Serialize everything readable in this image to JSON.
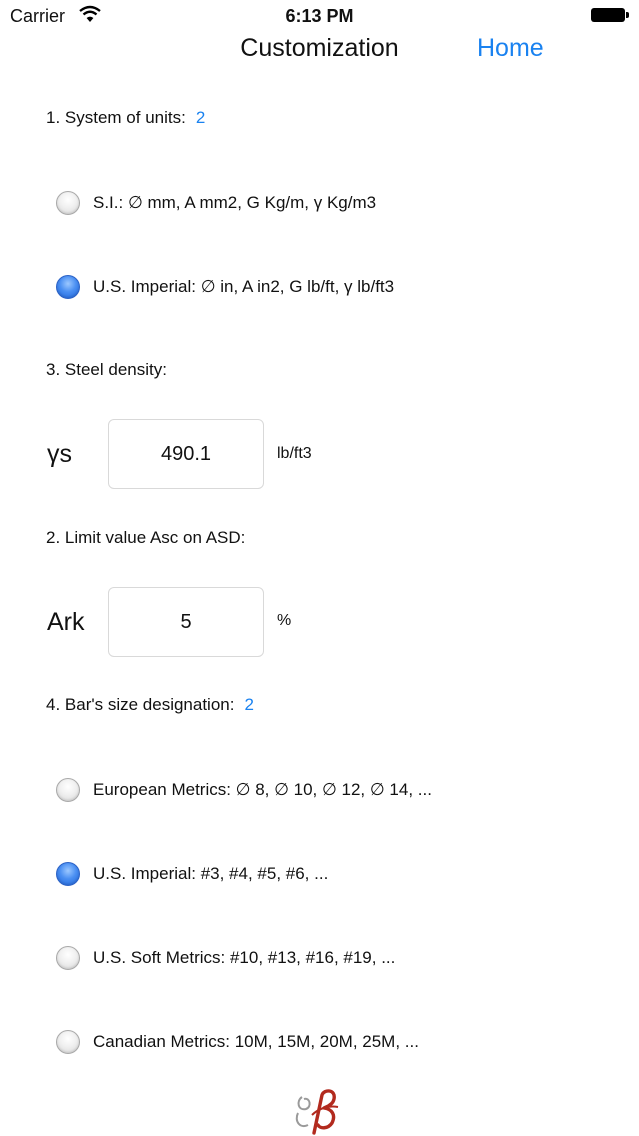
{
  "status_bar": {
    "carrier": "Carrier",
    "time": "6:13 PM"
  },
  "nav": {
    "title": "Customization",
    "home": "Home"
  },
  "units_section": {
    "label": "1. System of units:",
    "count": "2",
    "options": [
      {
        "label": "S.I.: ∅ mm, A mm2, G Kg/m, γ Kg/m3",
        "selected": false
      },
      {
        "label": "U.S. Imperial: ∅ in, A in2, G lb/ft, γ lb/ft3",
        "selected": true
      }
    ]
  },
  "density_section": {
    "label": "3. Steel density:",
    "symbol": "γs",
    "value": "490.1",
    "unit": "lb/ft3"
  },
  "limit_section": {
    "label": "2. Limit value Asc on ASD:",
    "symbol": "Ark",
    "value": "5",
    "unit": "%"
  },
  "bar_section": {
    "label": "4. Bar's size designation:",
    "count": "2",
    "options": [
      {
        "label": "European Metrics: ∅ 8, ∅ 10, ∅ 12, ∅ 14, ...",
        "selected": false
      },
      {
        "label": "U.S. Imperial: #3, #4, #5, #6, ...",
        "selected": true
      },
      {
        "label": "U.S. Soft Metrics: #10, #13, #16, #19, ...",
        "selected": false
      },
      {
        "label": "Canadian Metrics: 10M, 15M, 20M,  25M, ...",
        "selected": false
      }
    ]
  },
  "colors": {
    "accent": "#1a82f0",
    "radio_on": "#2f7ae8",
    "logo": "#b22a1e"
  },
  "icons": {
    "wifi": "wifi-icon",
    "battery": "battery-icon",
    "logo": "beta-logo-icon"
  }
}
